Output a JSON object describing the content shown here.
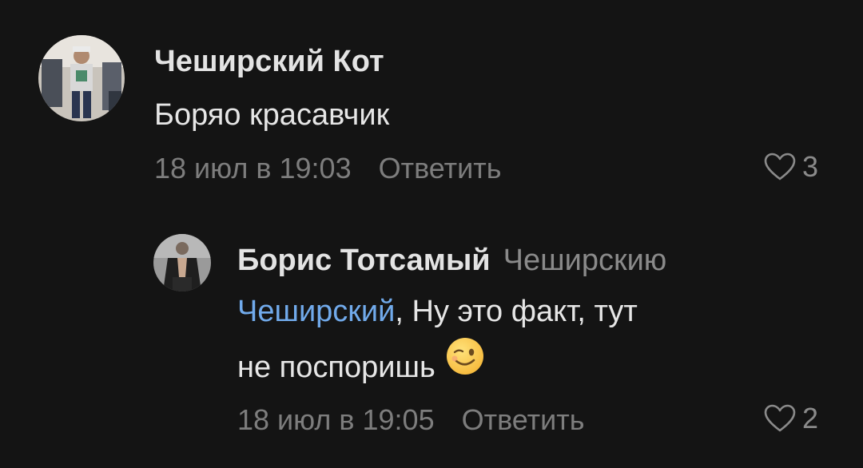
{
  "comments": [
    {
      "author": "Чеширский Кот",
      "text": "Боряо красавчик",
      "date": "18 июл в 19:03",
      "reply_label": "Ответить",
      "likes": "3",
      "avatar_icon": "avatar-photo"
    },
    {
      "author": "Борис Тотсамый",
      "reply_to": "Чеширскию",
      "mention": "Чеширский",
      "text_after_mention": ", Ну это факт, тут",
      "text_line2": "не поспоришь",
      "emoji_icon": "winking-face-emoji",
      "date": "18 июл в 19:05",
      "reply_label": "Ответить",
      "likes": "2",
      "avatar_icon": "avatar-photo"
    }
  ],
  "colors": {
    "background": "#141414",
    "mention": "#71aaeb",
    "meta": "#7d7d7d"
  }
}
